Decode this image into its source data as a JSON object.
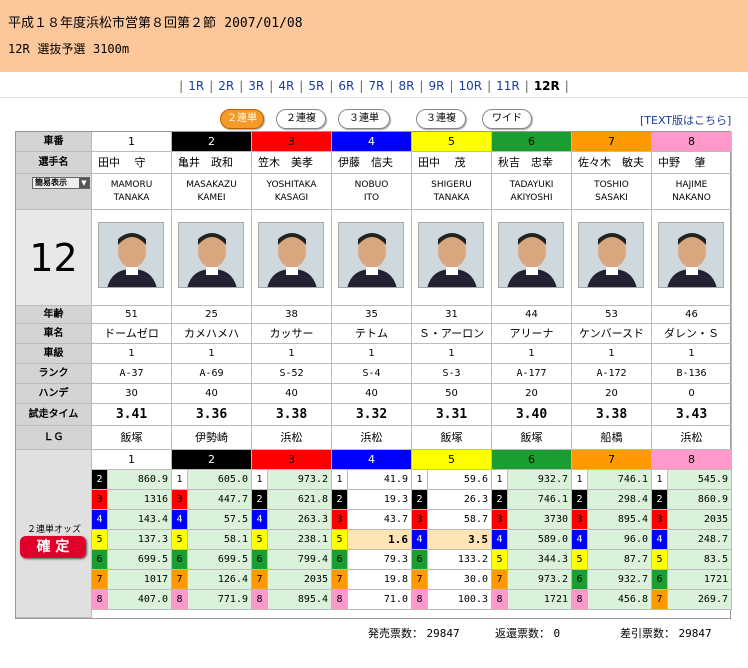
{
  "header": {
    "title": "平成１８年度浜松市営第８回第２節",
    "date": "2007/01/08",
    "race": "12R",
    "race_type": "選抜予選",
    "distance": "3100m"
  },
  "race_nav": {
    "items": [
      "1R",
      "2R",
      "3R",
      "4R",
      "5R",
      "6R",
      "7R",
      "8R",
      "9R",
      "10R",
      "11R",
      "12R"
    ],
    "current": "12R"
  },
  "bet_tabs": {
    "items": [
      "２連単",
      "２連複",
      "３連単",
      "３連複",
      "ワイド"
    ],
    "active": "２連単"
  },
  "text_link": "[TEXT版はこちら]",
  "labels": {
    "car_no": "車番",
    "rider_name": "選手名",
    "simple_view": "簡易表示",
    "age": "年齢",
    "bike_name": "車名",
    "class": "車級",
    "rank": "ランク",
    "handicap": "ハンデ",
    "trial_time": "試走タイム",
    "lg": "ＬＧ",
    "odds": "２連単オッズ",
    "confirmed": "確 定"
  },
  "race_big_number": "12",
  "riders": [
    {
      "no": "1",
      "name": "田中　 守",
      "roman1": "MAMORU",
      "roman2": "TANAKA",
      "age": "51",
      "bike": "ドームゼロ",
      "class": "1",
      "rank": "A-37",
      "handicap": "30",
      "trial": "3.41",
      "lg": "飯塚"
    },
    {
      "no": "2",
      "name": "亀井　政和",
      "roman1": "MASAKAZU",
      "roman2": "KAMEI",
      "age": "25",
      "bike": "カメハメハ",
      "class": "1",
      "rank": "A-69",
      "handicap": "40",
      "trial": "3.36",
      "lg": "伊勢崎"
    },
    {
      "no": "3",
      "name": "笠木　美孝",
      "roman1": "YOSHITAKA",
      "roman2": "KASAGI",
      "age": "38",
      "bike": "カッサー",
      "class": "1",
      "rank": "S-52",
      "handicap": "40",
      "trial": "3.38",
      "lg": "浜松"
    },
    {
      "no": "4",
      "name": "伊藤　信夫",
      "roman1": "NOBUO",
      "roman2": "ITO",
      "age": "35",
      "bike": "テトム",
      "class": "1",
      "rank": "S-4",
      "handicap": "40",
      "trial": "3.32",
      "lg": "浜松"
    },
    {
      "no": "5",
      "name": "田中　 茂",
      "roman1": "SHIGERU",
      "roman2": "TANAKA",
      "age": "31",
      "bike": "Ｓ・アーロン",
      "class": "1",
      "rank": "S-3",
      "handicap": "50",
      "trial": "3.31",
      "lg": "飯塚"
    },
    {
      "no": "6",
      "name": "秋吉　忠幸",
      "roman1": "TADAYUKI",
      "roman2": "AKIYOSHI",
      "age": "44",
      "bike": "アリーナ",
      "class": "1",
      "rank": "A-177",
      "handicap": "20",
      "trial": "3.40",
      "lg": "飯塚"
    },
    {
      "no": "7",
      "name": "佐々木　敏夫",
      "roman1": "TOSHIO",
      "roman2": "SASAKI",
      "age": "53",
      "bike": "ケンバースド",
      "class": "1",
      "rank": "A-172",
      "handicap": "20",
      "trial": "3.38",
      "lg": "船橋"
    },
    {
      "no": "8",
      "name": "中野　 肇",
      "roman1": "HAJIME",
      "roman2": "NAKANO",
      "age": "46",
      "bike": "ダレン・Ｓ",
      "class": "1",
      "rank": "B-136",
      "handicap": "0",
      "trial": "3.43",
      "lg": "浜松"
    }
  ],
  "odds": [
    [
      {
        "p": "2",
        "v": "860.9"
      },
      {
        "p": "3",
        "v": "1316"
      },
      {
        "p": "4",
        "v": "143.4"
      },
      {
        "p": "5",
        "v": "137.3"
      },
      {
        "p": "6",
        "v": "699.5"
      },
      {
        "p": "7",
        "v": "1017"
      },
      {
        "p": "8",
        "v": "407.0"
      }
    ],
    [
      {
        "p": "1",
        "v": "605.0"
      },
      {
        "p": "3",
        "v": "447.7"
      },
      {
        "p": "4",
        "v": "57.5"
      },
      {
        "p": "5",
        "v": "58.1"
      },
      {
        "p": "6",
        "v": "699.5"
      },
      {
        "p": "7",
        "v": "126.4"
      },
      {
        "p": "8",
        "v": "771.9"
      }
    ],
    [
      {
        "p": "1",
        "v": "973.2"
      },
      {
        "p": "2",
        "v": "621.8"
      },
      {
        "p": "4",
        "v": "263.3"
      },
      {
        "p": "5",
        "v": "238.1"
      },
      {
        "p": "6",
        "v": "799.4"
      },
      {
        "p": "7",
        "v": "2035"
      },
      {
        "p": "8",
        "v": "895.4"
      }
    ],
    [
      {
        "p": "1",
        "v": "41.9"
      },
      {
        "p": "2",
        "v": "19.3"
      },
      {
        "p": "3",
        "v": "43.7"
      },
      {
        "p": "5",
        "v": "1.6"
      },
      {
        "p": "6",
        "v": "79.3"
      },
      {
        "p": "7",
        "v": "19.8"
      },
      {
        "p": "8",
        "v": "71.0"
      }
    ],
    [
      {
        "p": "1",
        "v": "59.6"
      },
      {
        "p": "2",
        "v": "26.3"
      },
      {
        "p": "3",
        "v": "58.7"
      },
      {
        "p": "4",
        "v": "3.5"
      },
      {
        "p": "6",
        "v": "133.2"
      },
      {
        "p": "7",
        "v": "30.0"
      },
      {
        "p": "8",
        "v": "100.3"
      }
    ],
    [
      {
        "p": "1",
        "v": "932.7"
      },
      {
        "p": "2",
        "v": "746.1"
      },
      {
        "p": "3",
        "v": "3730"
      },
      {
        "p": "4",
        "v": "589.0"
      },
      {
        "p": "5",
        "v": "344.3"
      },
      {
        "p": "7",
        "v": "973.2"
      },
      {
        "p": "8",
        "v": "1721"
      }
    ],
    [
      {
        "p": "1",
        "v": "746.1"
      },
      {
        "p": "2",
        "v": "298.4"
      },
      {
        "p": "3",
        "v": "895.4"
      },
      {
        "p": "4",
        "v": "96.0"
      },
      {
        "p": "5",
        "v": "87.7"
      },
      {
        "p": "6",
        "v": "932.7"
      },
      {
        "p": "8",
        "v": "456.8"
      }
    ],
    [
      {
        "p": "1",
        "v": "545.9"
      },
      {
        "p": "2",
        "v": "860.9"
      },
      {
        "p": "3",
        "v": "2035"
      },
      {
        "p": "4",
        "v": "248.7"
      },
      {
        "p": "5",
        "v": "83.5"
      },
      {
        "p": "6",
        "v": "1721"
      },
      {
        "p": "7",
        "v": "269.7"
      }
    ]
  ],
  "footer": {
    "sales_label": "発売票数：",
    "sales": "29847",
    "refund_label": "返還票数：",
    "refund": "0",
    "net_label": "差引票数：",
    "net": "29847"
  },
  "colors": {
    "car_bg": [
      "#ffffff",
      "#000000",
      "#ff0000",
      "#0000ff",
      "#ffff00",
      "#1a9e32",
      "#ff9900",
      "#ff99cc"
    ],
    "car_fg": [
      "#000000",
      "#ffffff",
      "#000000",
      "#ffffff",
      "#000000",
      "#000000",
      "#000000",
      "#000000"
    ],
    "odds_bg": [
      "#d9f2d9",
      "#d9f2d9",
      "#d9f2d9",
      "#ffffff",
      "#ffffff",
      "#d9f2d9",
      "#d9f2d9",
      "#d9f2d9"
    ],
    "header_bg": "#fcc79a",
    "active_tab": "#f59a26",
    "highlight": "#ffe4b5"
  }
}
